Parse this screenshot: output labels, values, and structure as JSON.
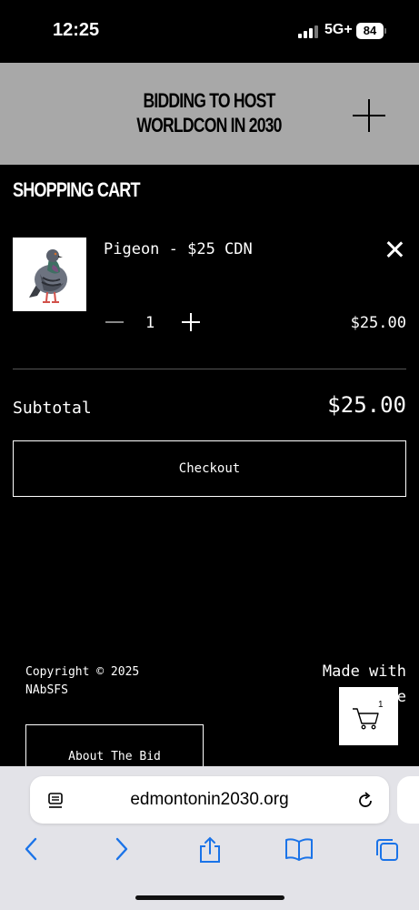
{
  "status_bar": {
    "time": "12:25",
    "network": "5G+",
    "battery": "84"
  },
  "header": {
    "title": "BIDDING TO HOST WORLDCON IN 2030",
    "menu_icon": "plus-icon"
  },
  "cart": {
    "heading": "SHOPPING CART",
    "items": [
      {
        "name": "Pigeon - $25 CDN",
        "quantity": "1",
        "price": "$25.00",
        "image": "pigeon-image"
      }
    ],
    "subtotal_label": "Subtotal",
    "subtotal_value": "$25.00",
    "checkout_label": "Checkout"
  },
  "footer": {
    "copyright_line1": "Copyright © 2025",
    "copyright_line2": "NAbSFS",
    "made_with_line1": "Made with",
    "made_with_line2": "Square",
    "about_label": "About The Bid"
  },
  "floating_cart": {
    "count": "1",
    "icon": "cart-icon"
  },
  "browser": {
    "url": "edmontonin2030.org"
  }
}
